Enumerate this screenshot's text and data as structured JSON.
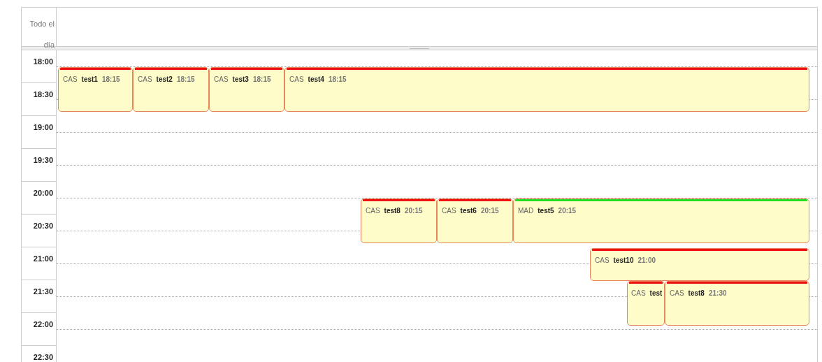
{
  "all_day": {
    "label": "Todo el día"
  },
  "time_slots": [
    "18:00",
    "18:30",
    "19:00",
    "19:30",
    "20:00",
    "20:30",
    "21:00",
    "21:30",
    "22:00",
    "22:30"
  ],
  "events": [
    {
      "code": "CAS",
      "title": "test1",
      "time": "18:15",
      "color": "#ee1111"
    },
    {
      "code": "CAS",
      "title": "test2",
      "time": "18:15",
      "color": "#ee1111"
    },
    {
      "code": "CAS",
      "title": "test3",
      "time": "18:15",
      "color": "#ee1111"
    },
    {
      "code": "CAS",
      "title": "test4",
      "time": "18:15",
      "color": "#ee1111"
    },
    {
      "code": "CAS",
      "title": "test8",
      "time": "20:15",
      "color": "#ee1111"
    },
    {
      "code": "CAS",
      "title": "test6",
      "time": "20:15",
      "color": "#ee1111"
    },
    {
      "code": "MAD",
      "title": "test5",
      "time": "20:15",
      "color": "#22dd22"
    },
    {
      "code": "CAS",
      "title": "test10",
      "time": "21:00",
      "color": "#ee1111"
    },
    {
      "code": "CAS",
      "title": "test",
      "color": "#ee1111"
    },
    {
      "code": "CAS",
      "title": "test8",
      "time": "21:30",
      "color": "#ee1111"
    }
  ]
}
